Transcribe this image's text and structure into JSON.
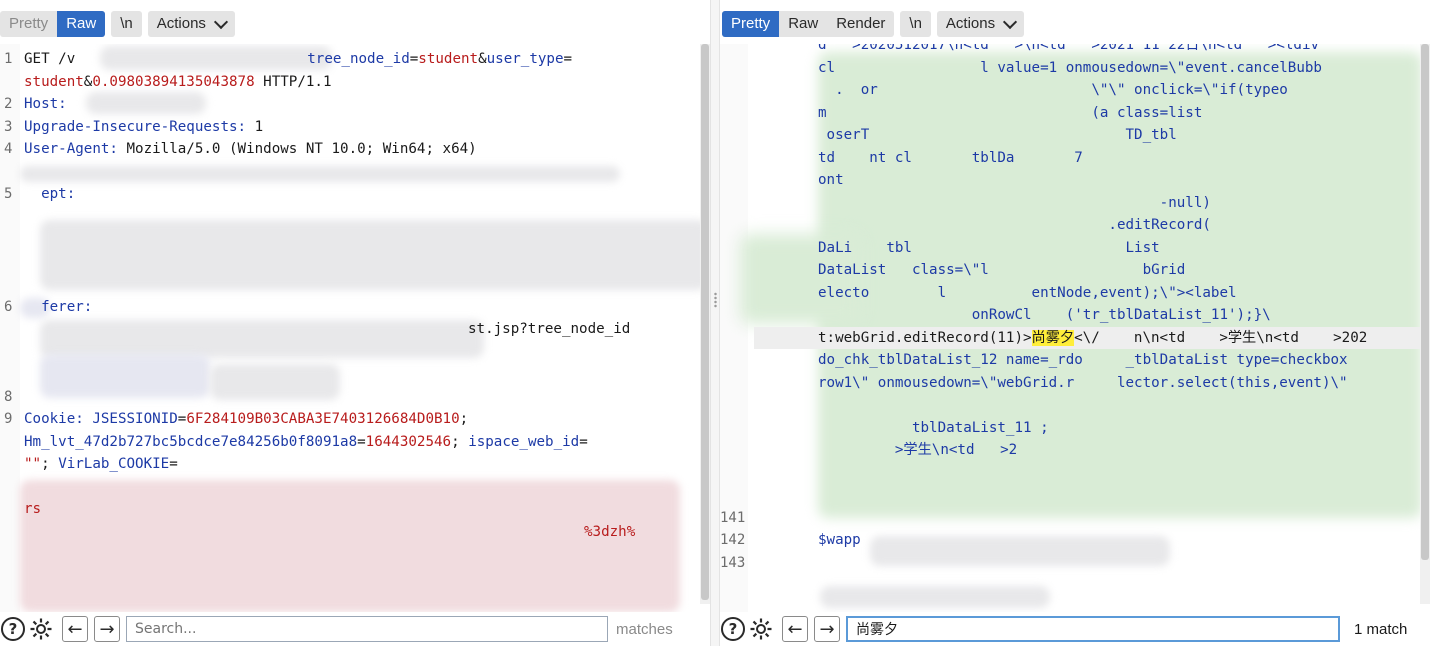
{
  "request": {
    "tabs": [
      "Pretty",
      "Raw"
    ],
    "active_tab": "Raw",
    "newline_btn": "\\n",
    "actions_btn": "Actions",
    "lines": [
      {
        "n": "1",
        "parts": [
          [
            "k",
            "GET /v"
          ],
          [
            "gap",
            ""
          ],
          [
            "hn",
            "tree_node_id"
          ],
          [
            "p",
            "="
          ],
          [
            "hv",
            "student"
          ],
          [
            "p",
            "&"
          ],
          [
            "hn",
            "user_type"
          ],
          [
            "p",
            "="
          ]
        ]
      },
      {
        "n": "",
        "parts": [
          [
            "hv",
            "student"
          ],
          [
            "p",
            "&"
          ],
          [
            "hv",
            "0.09803894135043878"
          ],
          [
            "p",
            " HTTP/1.1"
          ]
        ]
      },
      {
        "n": "2",
        "parts": [
          [
            "hn",
            "Host: "
          ]
        ]
      },
      {
        "n": "3",
        "parts": [
          [
            "hn",
            "Upgrade-Insecure-Requests: "
          ],
          [
            "p",
            "1"
          ]
        ]
      },
      {
        "n": "4",
        "parts": [
          [
            "hn",
            "User-Agent: "
          ],
          [
            "p",
            "Mozilla/5.0 (Windows NT 10.0; Win64; x64)"
          ]
        ]
      },
      {
        "n": "",
        "parts": []
      },
      {
        "n": "5",
        "parts": [
          [
            "hn",
            "  ept:"
          ]
        ]
      },
      {
        "n": "",
        "parts": []
      },
      {
        "n": "",
        "parts": []
      },
      {
        "n": "",
        "parts": []
      },
      {
        "n": "",
        "parts": []
      },
      {
        "n": "6",
        "parts": [
          [
            "hn",
            "  ferer:"
          ]
        ]
      },
      {
        "n": "",
        "parts": [
          [
            "gap",
            ""
          ],
          [
            "p",
            "st.jsp?tree_node_id"
          ]
        ]
      },
      {
        "n": "",
        "parts": []
      },
      {
        "n": "",
        "parts": []
      },
      {
        "n": "8",
        "parts": []
      },
      {
        "n": "9",
        "parts": [
          [
            "hn",
            "Cookie: "
          ],
          [
            "hn",
            "JSESSIONID"
          ],
          [
            "p",
            "="
          ],
          [
            "hv",
            "6F284109B03CABA3E7403126684D0B10"
          ],
          [
            "p",
            ";"
          ]
        ]
      },
      {
        "n": "",
        "parts": [
          [
            "hn",
            "Hm_lvt_47d2b727bc5bcdce7e84256b0f8091a8"
          ],
          [
            "p",
            "="
          ],
          [
            "hv",
            "1644302546"
          ],
          [
            "p",
            "; "
          ],
          [
            "hn",
            "ispace_web_id"
          ],
          [
            "p",
            "="
          ]
        ]
      },
      {
        "n": "",
        "parts": [
          [
            "hv",
            "\"\""
          ],
          [
            "p",
            "; "
          ],
          [
            "hn",
            "VirLab_COOKIE"
          ],
          [
            "p",
            "="
          ]
        ]
      },
      {
        "n": "",
        "parts": []
      },
      {
        "n": "",
        "parts": [
          [
            "hv",
            "rs"
          ]
        ]
      },
      {
        "n": "",
        "parts": [
          [
            "gap",
            ""
          ],
          [
            "hv",
            "%3dzh%"
          ]
        ]
      }
    ],
    "search_placeholder": "Search...",
    "matches_label": "matches"
  },
  "response": {
    "tabs": [
      "Pretty",
      "Raw",
      "Render"
    ],
    "active_tab": "Pretty",
    "newline_btn": "\\n",
    "actions_btn": "Actions",
    "lines": [
      {
        "n": "",
        "t": "d   >2020512017\\n<td   >\\n<td   >2021 11 22日\\n<td   ><ldiv"
      },
      {
        "n": "",
        "t": "cl                 l value=1 onmousedown=\\\"event.cancelBubb"
      },
      {
        "n": "",
        "t": "  .  or                         \\\"\\\" onclick=\\\"if(typeo"
      },
      {
        "n": "",
        "t": "m                               (a class=list"
      },
      {
        "n": "",
        "t": " oserT                              TD_tbl"
      },
      {
        "n": "",
        "t": "td    nt cl       tblDa       7"
      },
      {
        "n": "",
        "t": "ont                                         "
      },
      {
        "n": "",
        "t": "                                        -null)"
      },
      {
        "n": "",
        "t": "                                  .editRecord("
      },
      {
        "n": "",
        "t": "DaLi    tbl                         List"
      },
      {
        "n": "",
        "t": "DataList   class=\\\"l                  bGrid"
      },
      {
        "n": "",
        "t": "electo        l          entNode,event);\\\"><label"
      },
      {
        "n": "",
        "t": "                  onRowCl    ('tr_tblDataList_11');}\\"
      },
      {
        "n": "",
        "hl": true,
        "pre": "t:webGrid.editRecord(11)>",
        "mark": "尚雾夕",
        "post": "<\\/    n\\n<td    >学生\\n<td    >202"
      },
      {
        "n": "",
        "t": "do_chk_tblDataList_12 name=_rdo     _tblDataList type=checkbox"
      },
      {
        "n": "",
        "t": "row1\\\" onmousedown=\\\"webGrid.r     lector.select(this,event)\\\""
      },
      {
        "n": "",
        "t": ""
      },
      {
        "n": "",
        "t": "           tblDataList_11 ;"
      },
      {
        "n": "",
        "t": "         >学生\\n<td   >2"
      },
      {
        "n": "",
        "t": ""
      },
      {
        "n": "",
        "t": ""
      },
      {
        "n": "141",
        "t": ""
      },
      {
        "n": "142",
        "t": "$wapp"
      },
      {
        "n": "143",
        "t": ""
      }
    ],
    "search_value": "尚雾夕",
    "matches_label": "1 match"
  }
}
